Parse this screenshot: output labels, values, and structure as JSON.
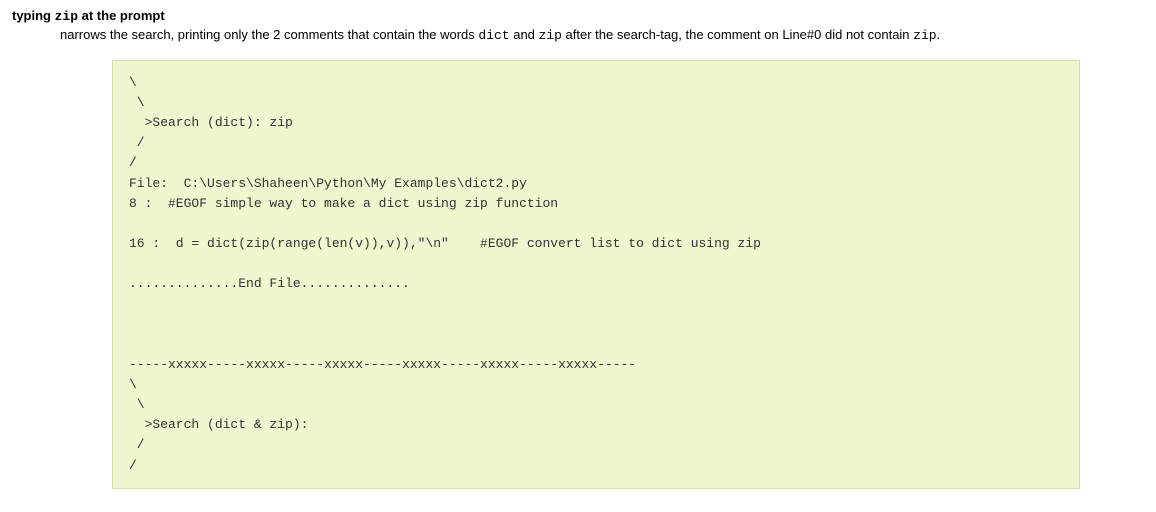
{
  "heading": {
    "prefix": "typing ",
    "keyword": "zip",
    "suffix": " at the prompt"
  },
  "description": {
    "t1": "narrows the search, printing only the 2 comments that contain the words ",
    "kw1": "dict",
    "t2": " and ",
    "kw2": "zip",
    "t3": " after the search-tag, the comment on Line#0 did not contain ",
    "kw3": "zip",
    "t4": "."
  },
  "code": "\\\n \\\n  >Search (dict): zip\n /\n/\nFile:  C:\\Users\\Shaheen\\Python\\My Examples\\dict2.py\n8 :  #EGOF simple way to make a dict using zip function\n\n16 :  d = dict(zip(range(len(v)),v)),\"\\n\"    #EGOF convert list to dict using zip\n\n..............End File..............\n\n\n\n-----xxxxx-----xxxxx-----xxxxx-----xxxxx-----xxxxx-----xxxxx-----\n\\\n \\\n  >Search (dict & zip):\n /\n/"
}
